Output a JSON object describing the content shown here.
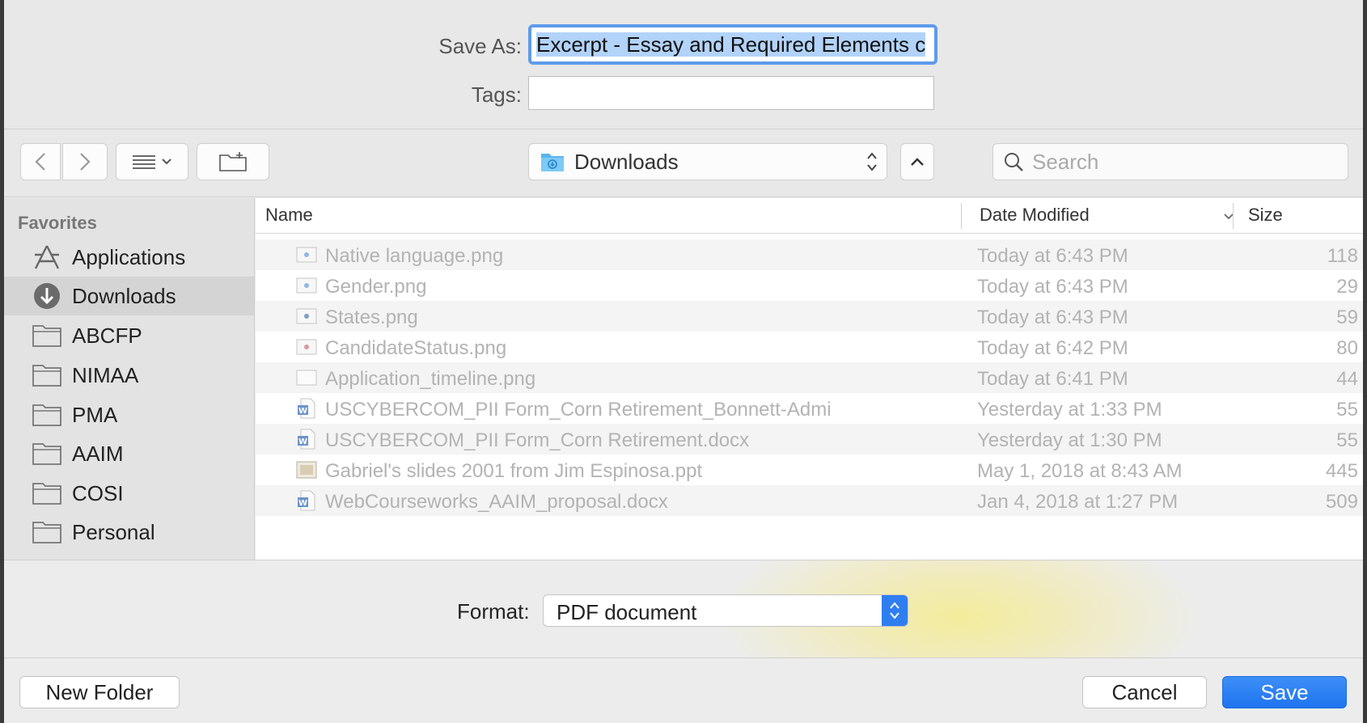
{
  "save_as": {
    "label": "Save As:",
    "value": "Excerpt - Essay and Required Elements c"
  },
  "tags": {
    "label": "Tags:",
    "value": ""
  },
  "toolbar": {
    "location": "Downloads",
    "search_placeholder": "Search"
  },
  "sidebar": {
    "heading": "Favorites",
    "items": [
      {
        "label": "Applications",
        "icon": "applications-icon"
      },
      {
        "label": "Downloads",
        "icon": "downloads-icon",
        "selected": true
      },
      {
        "label": "ABCFP",
        "icon": "folder-icon"
      },
      {
        "label": "NIMAA",
        "icon": "folder-icon"
      },
      {
        "label": "PMA",
        "icon": "folder-icon"
      },
      {
        "label": "AAIM",
        "icon": "folder-icon"
      },
      {
        "label": "COSI",
        "icon": "folder-icon"
      },
      {
        "label": "Personal",
        "icon": "folder-icon"
      }
    ]
  },
  "columns": {
    "name": "Name",
    "date": "Date Modified",
    "size": "Size"
  },
  "files": [
    {
      "name": "Native language.png",
      "date": "Today at 6:43 PM",
      "size": "118",
      "icon": "image-file-icon"
    },
    {
      "name": "Gender.png",
      "date": "Today at 6:43 PM",
      "size": "29",
      "icon": "image-file-icon"
    },
    {
      "name": "States.png",
      "date": "Today at 6:43 PM",
      "size": "59",
      "icon": "image-file-icon"
    },
    {
      "name": "CandidateStatus.png",
      "date": "Today at 6:42 PM",
      "size": "80",
      "icon": "image-file-icon"
    },
    {
      "name": "Application_timeline.png",
      "date": "Today at 6:41 PM",
      "size": "44",
      "icon": "image-file-icon"
    },
    {
      "name": "USCYBERCOM_PII Form_Corn Retirement_Bonnett-Admi",
      "date": "Yesterday at 1:33 PM",
      "size": "55",
      "icon": "word-file-icon"
    },
    {
      "name": "USCYBERCOM_PII Form_Corn Retirement.docx",
      "date": "Yesterday at 1:30 PM",
      "size": "55",
      "icon": "word-file-icon"
    },
    {
      "name": "Gabriel's slides 2001 from Jim Espinosa.ppt",
      "date": "May 1, 2018 at 8:43 AM",
      "size": "445",
      "icon": "presentation-file-icon"
    },
    {
      "name": "WebCourseworks_AAIM_proposal.docx",
      "date": "Jan 4, 2018 at 1:27 PM",
      "size": "509",
      "icon": "word-file-icon"
    }
  ],
  "format": {
    "label": "Format:",
    "value": "PDF document"
  },
  "buttons": {
    "new_folder": "New Folder",
    "cancel": "Cancel",
    "save": "Save"
  },
  "colors": {
    "accent": "#2f7ef0",
    "selection": "#b2d3fa",
    "focus_ring": "#5f9bea"
  }
}
